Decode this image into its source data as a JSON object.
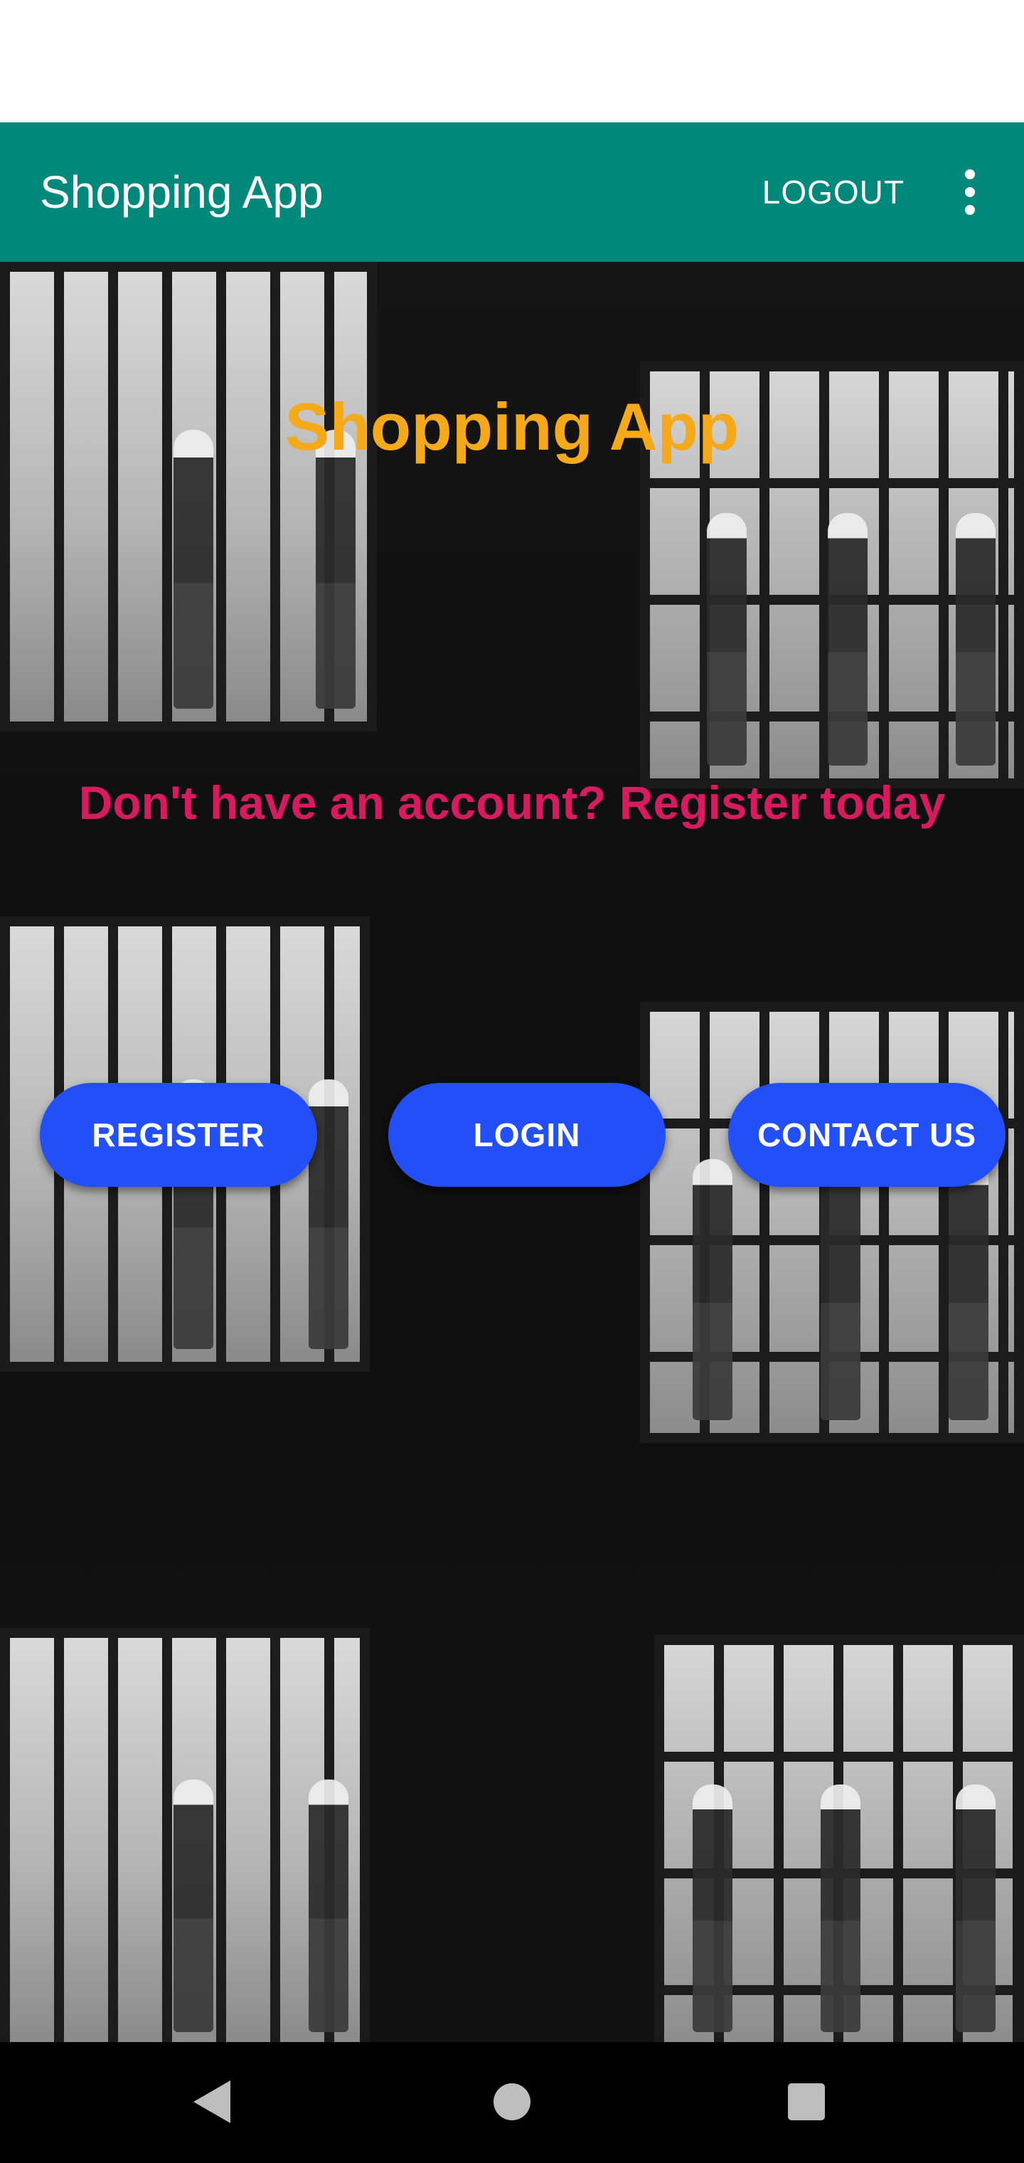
{
  "app_bar": {
    "title": "Shopping App",
    "logout_label": "LOGOUT",
    "overflow_icon": "more-vert-icon",
    "color": "#00897b"
  },
  "main": {
    "hero_title": "Shopping App",
    "hero_title_color": "#f4a91b",
    "cta_text": "Don't have an account? Register today",
    "cta_color": "#d81b60",
    "button_color": "#2350f6",
    "buttons": [
      {
        "label": "REGISTER"
      },
      {
        "label": "LOGIN"
      },
      {
        "label": "CONTACT US"
      }
    ]
  },
  "nav_bar": {
    "back_icon": "back-triangle-icon",
    "home_icon": "home-circle-icon",
    "recents_icon": "recents-square-icon"
  }
}
